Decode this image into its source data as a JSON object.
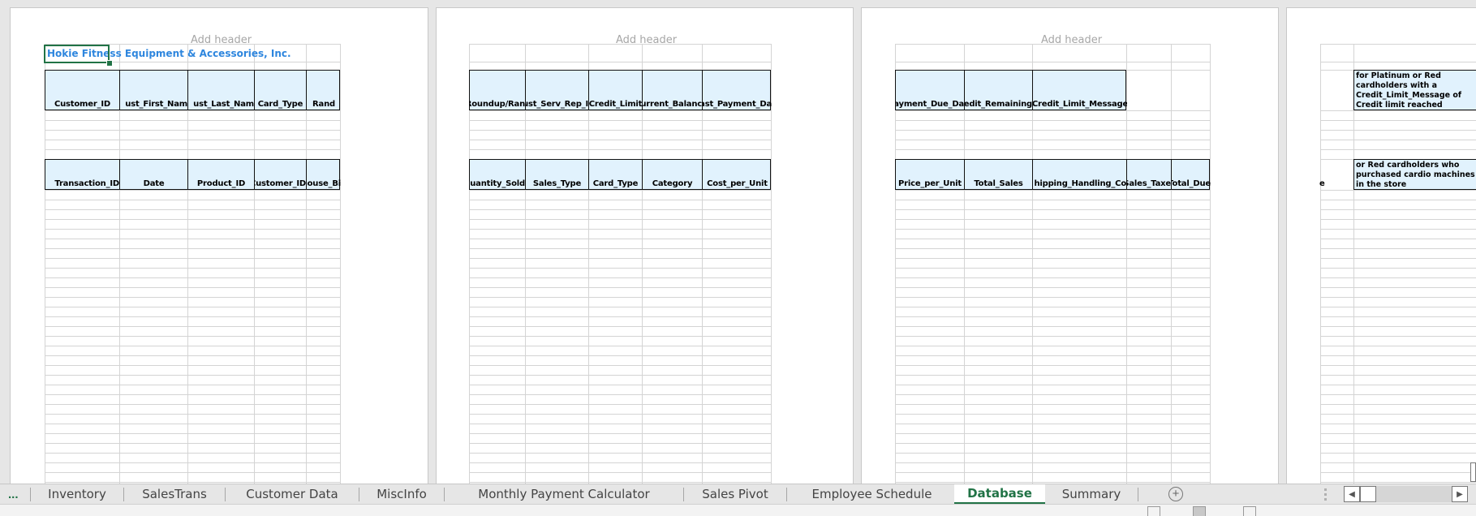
{
  "sheet": {
    "header_placeholder": "Add header",
    "title": "Hokie Fitness Equipment & Accessories, Inc.",
    "pages": [
      {
        "header_row_1": [
          "Customer_ID",
          "ust_First_Nam",
          "ust_Last_Nam",
          "Card_Type",
          "Rand"
        ],
        "header_row_2": [
          "Transaction_ID",
          "Date",
          "Product_ID",
          "Customer_ID",
          "Warehouse_Bi"
        ]
      },
      {
        "header_row_1": [
          "Roundup/Ran",
          "ust_Serv_Rep_I",
          "Credit_Limit",
          "Current_Balanc",
          "ast_Payment_Da"
        ],
        "header_row_2": [
          "Quantity_Sold",
          "Sales_Type",
          "Card_Type",
          "Category",
          "Cost_per_Unit"
        ]
      },
      {
        "header_row_1": [
          "ayment_Due_Da",
          "Credit_Remaining",
          "Credit_Limit_Message"
        ],
        "header_row_2": [
          "Price_per_Unit",
          "Total_Sales",
          "hipping_Handling_Co",
          "Sales_Taxe",
          "Total_Due"
        ]
      },
      {
        "note_1": "for Platinum or Red cardholders with a Credit_Limit_Message of Credit limit reached",
        "note_2": "or Red cardholders who purchased cardio machines in the store",
        "partial_text": "e"
      }
    ]
  },
  "tabs": {
    "more_label": "...",
    "items": [
      {
        "label": "Inventory",
        "active": false
      },
      {
        "label": "SalesTrans",
        "active": false
      },
      {
        "label": "Customer Data",
        "active": false
      },
      {
        "label": "MiscInfo",
        "active": false
      },
      {
        "label": "Monthly Payment Calculator",
        "active": false
      },
      {
        "label": "Sales Pivot",
        "active": false
      },
      {
        "label": "Employee Schedule",
        "active": false
      },
      {
        "label": "Database",
        "active": true
      },
      {
        "label": "Summary",
        "active": false
      }
    ],
    "add_sheet_icon": "+",
    "colors": {
      "active_tab": "#217346",
      "header_fill": "#e1f2fd",
      "title_text": "#2e86de"
    }
  }
}
